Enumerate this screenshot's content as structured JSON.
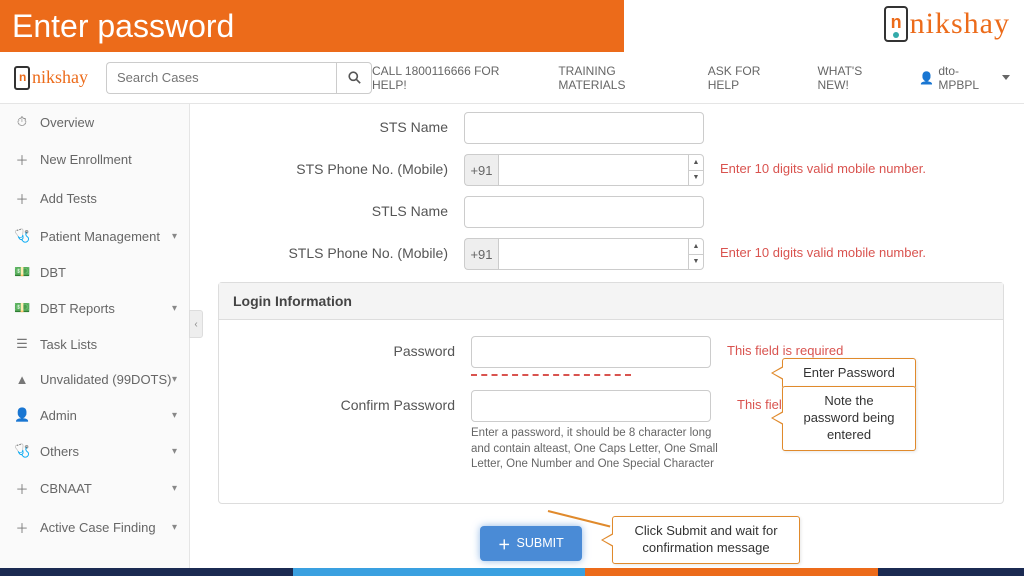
{
  "banner": {
    "title": "Enter password"
  },
  "brand": {
    "text": "nikshay",
    "n": "n"
  },
  "search": {
    "placeholder": "Search Cases"
  },
  "nav": {
    "help": "CALL 1800116666 FOR HELP!",
    "training": "TRAINING MATERIALS",
    "ask": "ASK FOR HELP",
    "whatsnew": "WHAT'S NEW!",
    "user": "dto-MPBPL"
  },
  "sidebar": {
    "items": [
      {
        "icon": "⏱",
        "label": "Overview"
      },
      {
        "icon": "＋",
        "label": "New Enrollment"
      },
      {
        "icon": "＋",
        "label": "Add Tests"
      },
      {
        "icon": "🩺",
        "label": "Patient Management",
        "chev": true
      },
      {
        "icon": "💵",
        "label": "DBT"
      },
      {
        "icon": "💵",
        "label": "DBT Reports",
        "chev": true
      },
      {
        "icon": "☰",
        "label": "Task Lists"
      },
      {
        "icon": "▲",
        "label": "Unvalidated (99DOTS)",
        "chev": true
      },
      {
        "icon": "👤",
        "label": "Admin",
        "chev": true
      },
      {
        "icon": "🩺",
        "label": "Others",
        "chev": true
      },
      {
        "icon": "＋",
        "label": "CBNAAT",
        "chev": true
      },
      {
        "icon": "＋",
        "label": "Active Case Finding",
        "chev": true
      }
    ]
  },
  "form": {
    "sts_name_label": "STS Name",
    "sts_phone_label": "STS Phone No. (Mobile)",
    "stls_name_label": "STLS Name",
    "stls_phone_label": "STLS Phone No. (Mobile)",
    "prefix": "+91",
    "phone_err": "Enter 10 digits valid mobile number."
  },
  "login": {
    "heading": "Login Information",
    "password_label": "Password",
    "confirm_label": "Confirm Password",
    "required_err": "This field is required",
    "hint": "Enter a password, it should be 8 character long and contain alteast, One Caps Letter, One Small Letter, One Number and One Special Character"
  },
  "submit": {
    "label": "SUBMIT"
  },
  "callouts": {
    "c1": "Enter Password",
    "c2": "Note the password being entered",
    "c3": "Click Submit and wait for confirmation message"
  },
  "stripe_colors": [
    "#1b2a52",
    "#1b2a52",
    "#3aa0e0",
    "#3aa0e0",
    "#ec6b1a",
    "#ec6b1a",
    "#1b2a52"
  ]
}
